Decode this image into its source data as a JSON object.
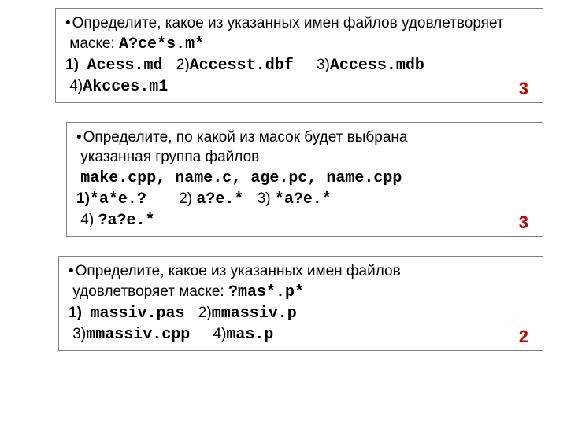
{
  "q1": {
    "bullet": "•",
    "prompt_a": "Определите, какое из указанных имен файлов удовлетворяет",
    "prompt_b": "маске:",
    "mask": "A?ce*s.m*",
    "n1": "1)",
    "o1": "Acess.md",
    "n2": "2)",
    "o2": "Accesst.dbf",
    "n3": "3)",
    "o3": "Access.mdb",
    "n4": "4)",
    "o4": "Akcces.m1",
    "answer": "3"
  },
  "q2": {
    "bullet": "•",
    "prompt_a": "Определите, по какой из масок будет выбрана",
    "prompt_b": "указанная группа файлов",
    "files": "make.cpp, name.c, age.pc, name.cpp",
    "n1": "1)",
    "o1": "*a*e.?",
    "n2": "2)",
    "o2": "a?e.*",
    "n3": "3)",
    "o3": "*a?e.*",
    "n4": "4)",
    "o4": "?a?e.*",
    "answer": "3"
  },
  "q3": {
    "bullet": "•",
    "prompt_a": "Определите, какое из указанных имен файлов",
    "prompt_b": "удовлетворяет маске:",
    "mask": "?mas*.p*",
    "n1": "1)",
    "o1": "massiv.pas",
    "n2": "2)",
    "o2": "mmassiv.p",
    "n3": "3)",
    "o3": "mmassiv.cpp",
    "n4": "4)",
    "o4": "mas.p",
    "answer": "2"
  }
}
